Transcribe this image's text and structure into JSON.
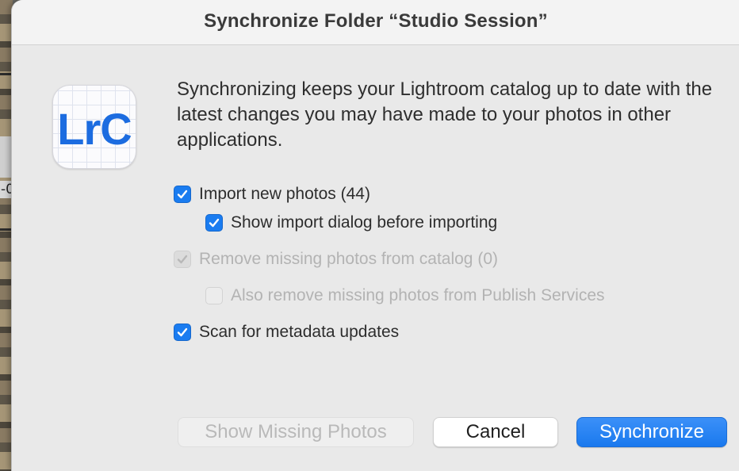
{
  "background": {
    "fragment_text": "-0"
  },
  "dialog": {
    "title": "Synchronize Folder “Studio Session”",
    "app_icon": {
      "name": "lightroom-classic-icon",
      "logo_text": "LrC",
      "accent_color": "#1c6ce0"
    },
    "description": "Synchronizing keeps your Lightroom catalog up to date with the latest changes you may have made to your photos in other applications.",
    "options": [
      {
        "label": "Import new photos (44)",
        "checked": true,
        "enabled": true
      },
      {
        "label": "Show import dialog before importing",
        "checked": true,
        "enabled": true
      },
      {
        "label": "Remove missing photos from catalog (0)",
        "checked": true,
        "enabled": false
      },
      {
        "label": "Also remove missing photos from Publish Services",
        "checked": false,
        "enabled": false
      },
      {
        "label": "Scan for metadata updates",
        "checked": true,
        "enabled": true
      }
    ],
    "buttons": {
      "show_missing": "Show Missing Photos",
      "cancel": "Cancel",
      "synchronize": "Synchronize"
    },
    "colors": {
      "checkbox_accent": "#1a7cf0",
      "primary_button": "#1a79ee"
    }
  }
}
